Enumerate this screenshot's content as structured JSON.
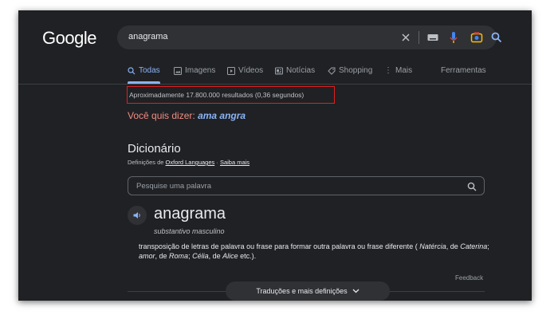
{
  "logo": "Google",
  "search": {
    "query": "anagrama"
  },
  "tabs": [
    {
      "label": "Todas"
    },
    {
      "label": "Imagens"
    },
    {
      "label": "Vídeos"
    },
    {
      "label": "Notícias"
    },
    {
      "label": "Shopping"
    },
    {
      "label": "Mais"
    },
    {
      "label": "Ferramentas"
    }
  ],
  "results": {
    "stats": "Aproximadamente 17.800.000 resultados (0,36 segundos)"
  },
  "did_you_mean": {
    "prefix": "Você quis dizer:",
    "suggestion": "ama angra"
  },
  "dictionary": {
    "title": "Dicionário",
    "source_prefix": "Definições de",
    "source_link": "Oxford Languages",
    "separator": "·",
    "learn_more": "Saiba mais",
    "search_placeholder": "Pesquise uma palavra",
    "word": "anagrama",
    "part_of_speech": "substantivo masculino",
    "definition_text": "transposição de letras de palavra ou frase para formar outra palavra ou frase diferente (",
    "example_1": "Natércia",
    "text_de_1": ", de",
    "example_2": "Caterina",
    "text_sep_1": "; ",
    "example_3": "amor",
    "text_de_2": ", de",
    "example_4": "Roma",
    "text_sep_2": "; ",
    "example_5": "Célia",
    "text_de_3": ", de",
    "example_6": "Alice",
    "text_end": "etc.).",
    "feedback": "Feedback",
    "more_button": "Traduções e mais definições"
  },
  "colors": {
    "background": "#202124",
    "accent": "#8ab4f8",
    "suggestion_red": "#f28b82",
    "highlight_border": "#e02020"
  }
}
